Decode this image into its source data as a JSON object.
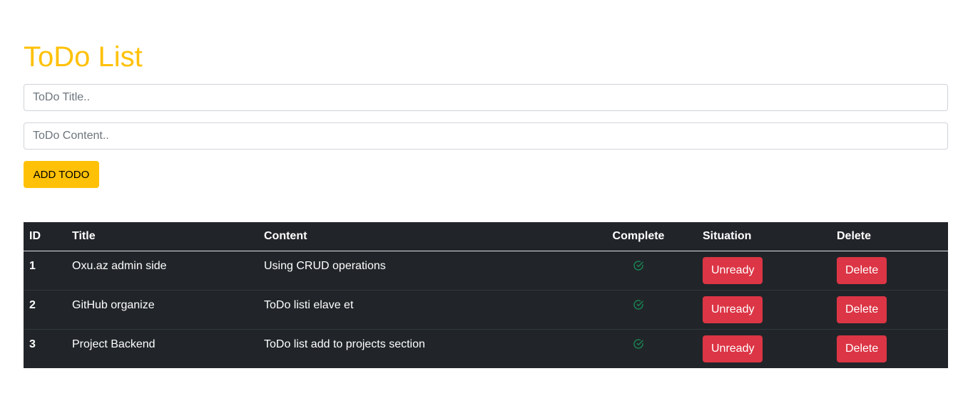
{
  "header": {
    "title": "ToDo List"
  },
  "form": {
    "title_placeholder": "ToDo Title..",
    "title_value": "",
    "content_placeholder": "ToDo Content..",
    "content_value": "",
    "add_button_label": "ADD TODO"
  },
  "table": {
    "columns": {
      "id": "ID",
      "title": "Title",
      "content": "Content",
      "complete": "Complete",
      "situation": "Situation",
      "delete": "Delete"
    },
    "rows": [
      {
        "id": "1",
        "title": "Oxu.az admin side",
        "content": "Using CRUD operations",
        "complete_icon": "check-circle-icon",
        "situation_label": "Unready",
        "delete_label": "Delete"
      },
      {
        "id": "2",
        "title": "GitHub organize",
        "content": "ToDo listi elave et",
        "complete_icon": "check-circle-icon",
        "situation_label": "Unready",
        "delete_label": "Delete"
      },
      {
        "id": "3",
        "title": "Project Backend",
        "content": "ToDo list add to projects section",
        "complete_icon": "check-circle-icon",
        "situation_label": "Unready",
        "delete_label": "Delete"
      }
    ]
  },
  "colors": {
    "accent": "#ffc107",
    "danger": "#dc3545",
    "table_bg": "#212529",
    "success": "#198754"
  }
}
